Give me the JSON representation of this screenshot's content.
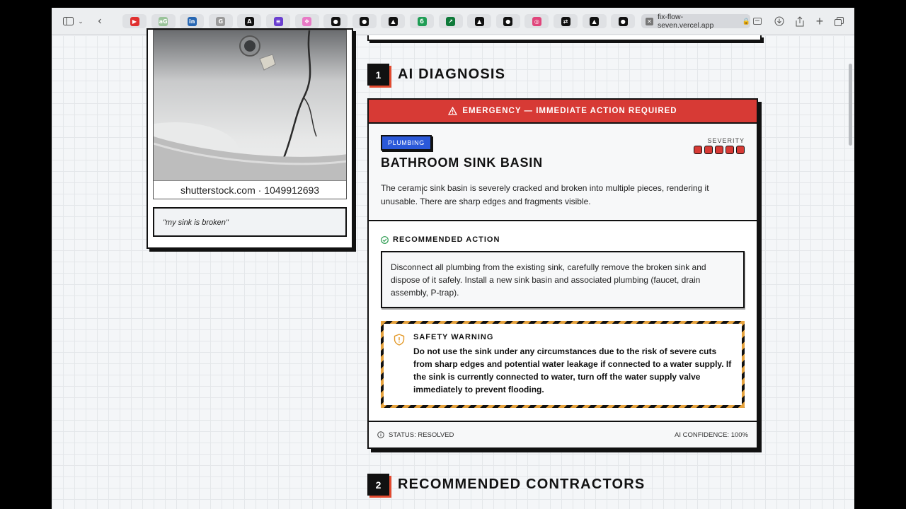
{
  "browser": {
    "tabs": [
      {
        "icon": "youtube-icon",
        "color": "#e03030",
        "glyph": "▶"
      },
      {
        "icon": "gamma-icon",
        "color": "#9ac49a",
        "glyph": "aG"
      },
      {
        "icon": "linkedin-icon",
        "color": "#2867b2",
        "glyph": "in"
      },
      {
        "icon": "google-icon",
        "color": "#9a9a9a",
        "glyph": "G"
      },
      {
        "icon": "analytics-icon",
        "color": "#111111",
        "glyph": "A"
      },
      {
        "icon": "forms-icon",
        "color": "#6a3fd0",
        "glyph": "≡"
      },
      {
        "icon": "figma-icon",
        "color": "#e87ac6",
        "glyph": "❖"
      },
      {
        "icon": "github-icon",
        "color": "#111111",
        "glyph": "●"
      },
      {
        "icon": "github-icon",
        "color": "#111111",
        "glyph": "●"
      },
      {
        "icon": "vercel-icon",
        "color": "#111111",
        "glyph": "▲"
      },
      {
        "icon": "leaf-icon",
        "color": "#1f9d55",
        "glyph": "б"
      },
      {
        "icon": "chart-icon",
        "color": "#0f7a3a",
        "glyph": "↗"
      },
      {
        "icon": "vercel-icon",
        "color": "#111111",
        "glyph": "▲"
      },
      {
        "icon": "github-icon",
        "color": "#111111",
        "glyph": "●"
      },
      {
        "icon": "dribbble-icon",
        "color": "#e0457b",
        "glyph": "◎"
      },
      {
        "icon": "replit-icon",
        "color": "#111111",
        "glyph": "⇄"
      },
      {
        "icon": "vercel-icon",
        "color": "#111111",
        "glyph": "▲"
      },
      {
        "icon": "github-icon",
        "color": "#111111",
        "glyph": "●"
      }
    ],
    "active_url": "fix-flow-seven.vercel.app"
  },
  "left_panel": {
    "photo_caption": "shutterstock.com · 1049912693",
    "user_quote": "\"my sink is broken\""
  },
  "section1": {
    "number": "1",
    "title": "AI DIAGNOSIS",
    "emergency_banner": "EMERGENCY — IMMEDIATE ACTION REQUIRED",
    "category_tag": "PLUMBING",
    "severity_label": "SEVERITY",
    "severity_level": 5,
    "severity_max": 5,
    "item_title": "BATHROOM SINK BASIN",
    "description": "The ceramic sink basin is severely cracked and broken into multiple pieces, rendering it unusable. There are sharp edges and fragments visible.",
    "recommended_label": "RECOMMENDED ACTION",
    "recommended_text": "Disconnect all plumbing from the existing sink, carefully remove the broken sink and dispose of it safely. Install a new sink basin and associated plumbing (faucet, drain assembly, P-trap).",
    "safety_label": "SAFETY WARNING",
    "safety_text": "Do not use the sink under any circumstances due to the risk of severe cuts from sharp edges and potential water leakage if connected to a water supply. If the sink is currently connected to water, turn off the water supply valve immediately to prevent flooding.",
    "status": "STATUS: RESOLVED",
    "confidence": "AI CONFIDENCE: 100%"
  },
  "section2": {
    "number": "2",
    "title": "RECOMMENDED CONTRACTORS"
  },
  "colors": {
    "emergency": "#d73a35",
    "tag": "#2b59d9",
    "accent": "#e34a2f",
    "hazard": "#e6a23c"
  }
}
